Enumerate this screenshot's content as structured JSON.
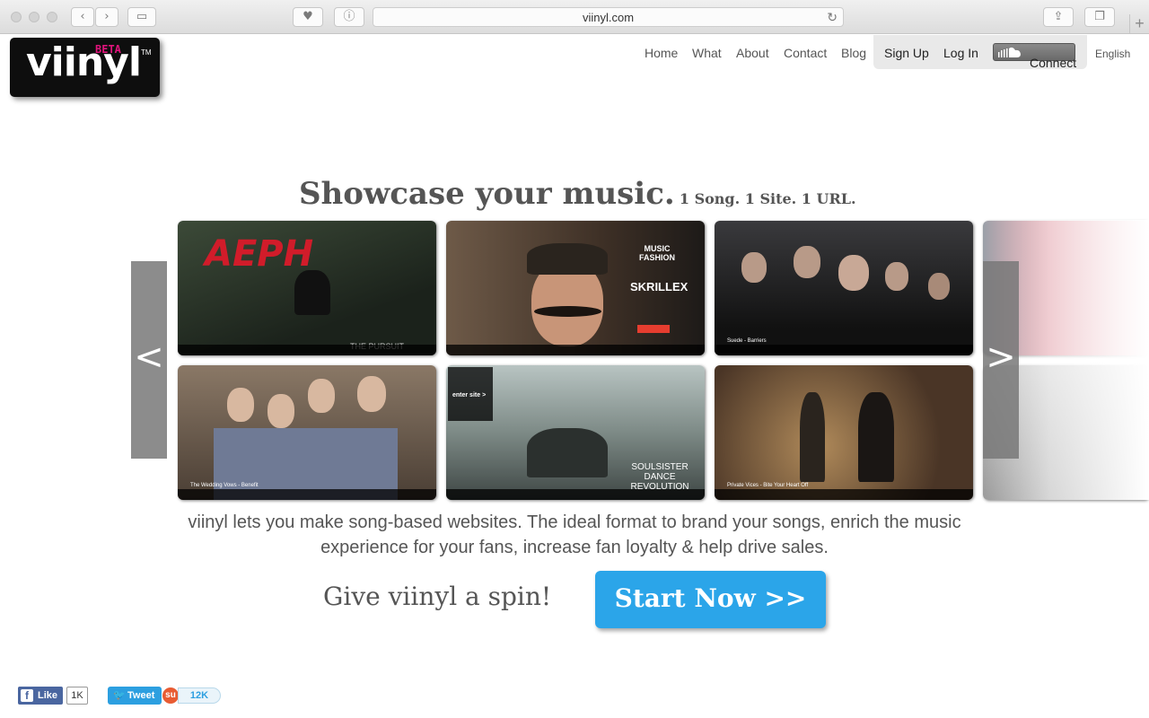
{
  "browser": {
    "url": "viinyl.com",
    "new_tab": "+"
  },
  "logo": {
    "text": "viinyl",
    "beta": "BETA",
    "tm": "TM"
  },
  "nav": {
    "home": "Home",
    "what": "What",
    "about": "About",
    "contact": "Contact",
    "blog": "Blog"
  },
  "account": {
    "signup": "Sign Up",
    "login": "Log In",
    "connect": "Connect"
  },
  "language": "English",
  "hero": {
    "headline": "Showcase your music.",
    "tagline": "1 Song. 1 Site. 1 URL."
  },
  "gallery": {
    "prev": "<",
    "next": ">",
    "tiles": [
      {
        "title": "AEPH",
        "caption": "THE PURSUIT",
        "bg": "#2c3328",
        "accent": "#d11c2a"
      },
      {
        "title": "MUSIC FASHION",
        "caption": "SKRILLEX",
        "bg": "#4a3c30",
        "accent": "#e63d2f"
      },
      {
        "title": "",
        "caption": "Suede - Barriers",
        "bg": "#1f1f21",
        "accent": "#d33"
      },
      {
        "title": "",
        "caption": "The Wedding Vows - Benefit",
        "bg": "#7a6a58",
        "accent": "#d33"
      },
      {
        "title": "enter site >",
        "caption": "SOULSISTER DANCE REVOLUTION",
        "bg": "#6b7472",
        "accent": "#fff"
      },
      {
        "title": "",
        "caption": "Private Vices - Bite Your Heart Off",
        "bg": "#4a3526",
        "accent": "#e0a040"
      }
    ]
  },
  "description": "viinyl lets you make song-based websites. The ideal format to brand your songs, enrich the music experience for your fans, increase fan loyalty & help drive sales.",
  "cta": {
    "spin": "Give viinyl a spin!",
    "start": "Start Now >>"
  },
  "social": {
    "like": "Like",
    "like_count": "1K",
    "tweet": "Tweet",
    "stumble_count": "12K"
  }
}
